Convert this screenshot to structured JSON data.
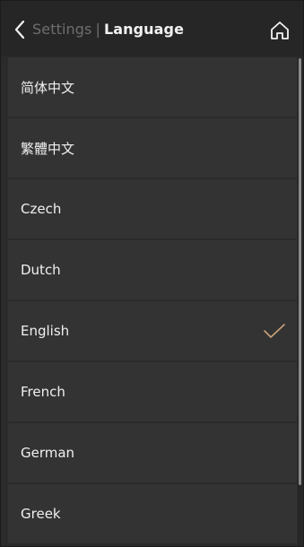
{
  "header": {
    "parent_label": "Settings",
    "separator": "|",
    "title": "Language"
  },
  "languages": [
    {
      "label": "简体中文",
      "selected": false
    },
    {
      "label": "繁體中文",
      "selected": false
    },
    {
      "label": "Czech",
      "selected": false
    },
    {
      "label": "Dutch",
      "selected": false
    },
    {
      "label": "English",
      "selected": true
    },
    {
      "label": "French",
      "selected": false
    },
    {
      "label": "German",
      "selected": false
    },
    {
      "label": "Greek",
      "selected": false
    }
  ],
  "icons": {
    "back": "chevron-left-icon",
    "home": "home-icon",
    "selected": "checkmark-icon"
  },
  "colors": {
    "background": "#2b2b2b",
    "header": "#262626",
    "item": "#333333",
    "text": "#f0f0f0",
    "muted_text": "#6e6e6e",
    "accent_check": "#c9a27a"
  }
}
